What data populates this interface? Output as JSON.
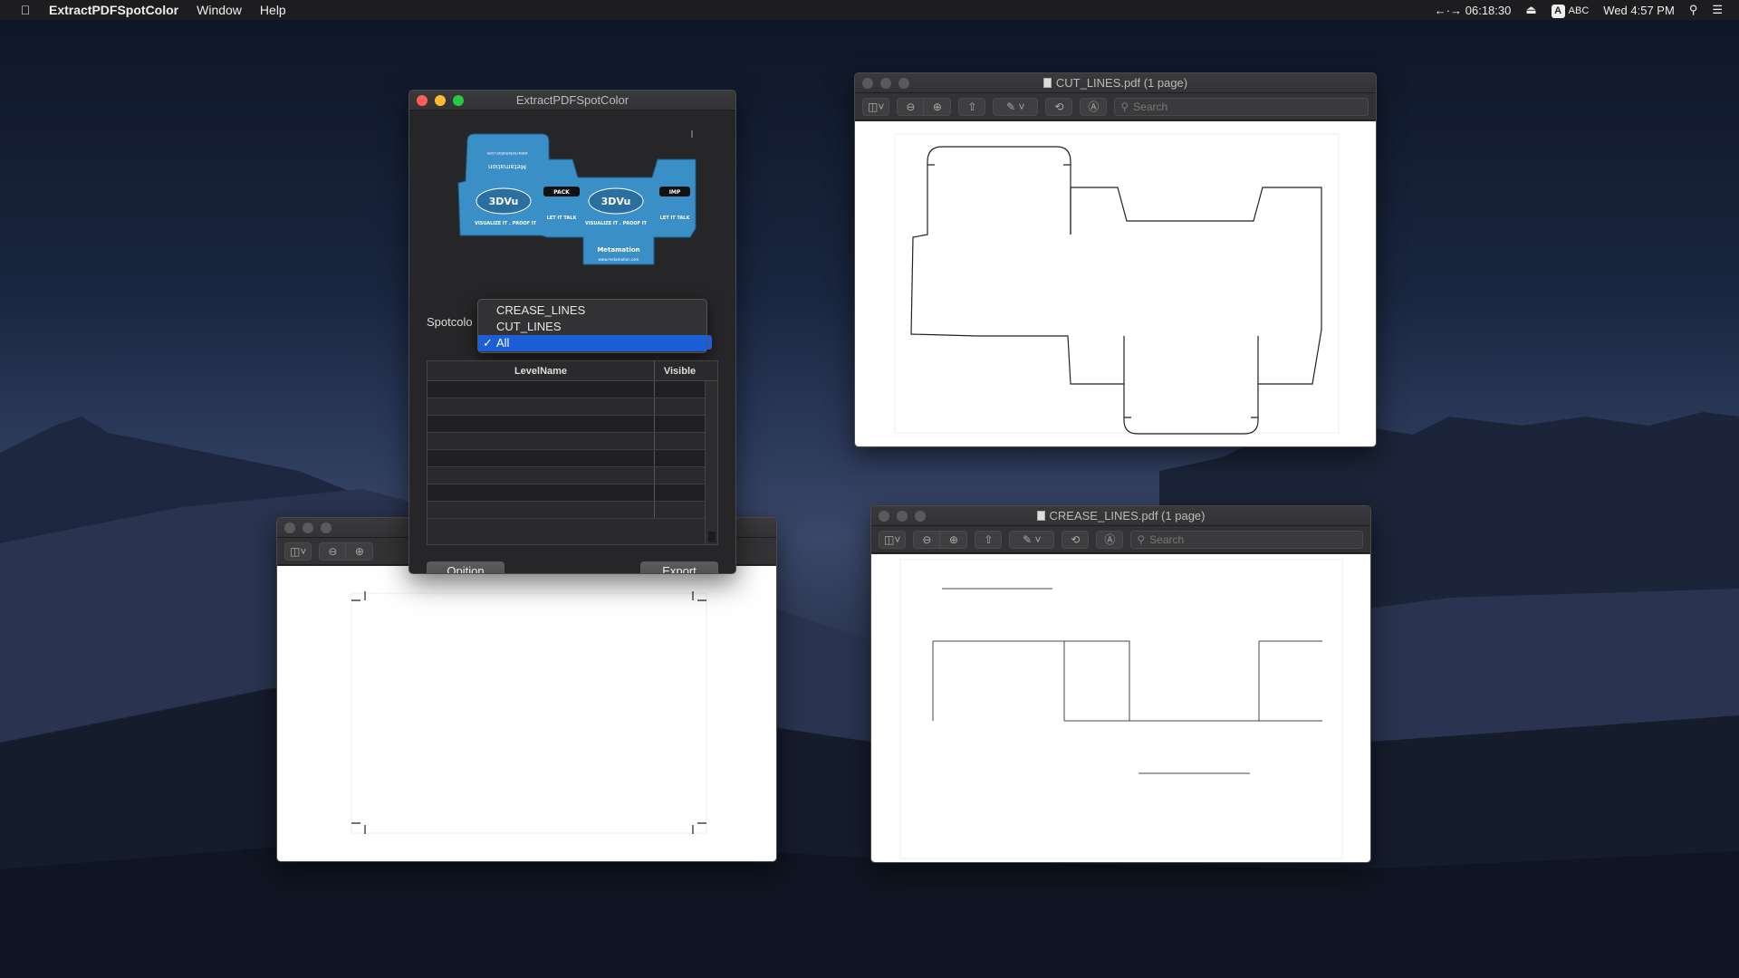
{
  "menubar": {
    "app_name": "ExtractPDFSpotColor",
    "menus": [
      "Window",
      "Help"
    ],
    "time_counter": "06:18:30",
    "input_source": "ABC",
    "input_badge": "A",
    "datetime": "Wed 4:57 PM"
  },
  "app_window": {
    "title": "ExtractPDFSpotColor",
    "spot_label": "Spotcolo",
    "dropdown_options": [
      "CREASE_LINES",
      "CUT_LINES",
      "All"
    ],
    "dropdown_selected": "All",
    "check_mark": "✓",
    "table": {
      "columns": [
        "LevelName",
        "Visible"
      ],
      "rows": 8
    },
    "option_button": "Opition",
    "export_button": "Export",
    "preview_texts": {
      "brand_1": "3DVu",
      "brand_2": "3DVu",
      "pack_label": "PACK",
      "imp_label": "IMP",
      "let_it_talk": "LET IT TALK",
      "slogan": "VISUALIZE IT . PROOF IT",
      "metamation": "Metamation",
      "metamation_inverted": "Metamation",
      "website_small": "www.metamation.com"
    }
  },
  "cut_window": {
    "title": "CUT_LINES.pdf (1 page)",
    "search_placeholder": "Search"
  },
  "crease_window": {
    "title": "CREASE_LINES.pdf (1 page)",
    "search_placeholder": "Search"
  },
  "third_window": {
    "title": ""
  },
  "colors": {
    "accent": "#1c5ed6",
    "close": "#fd5f57",
    "minimize": "#febc2e",
    "zoom": "#28c840",
    "box_blue": "#3a8fc7"
  }
}
